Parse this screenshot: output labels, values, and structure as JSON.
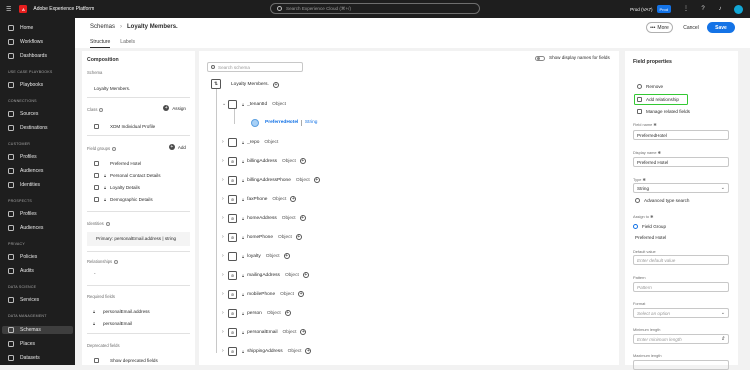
{
  "topbar": {
    "brand": "Adobe Experience Platform",
    "search_placeholder": "Search Experience Cloud (⌘+/)",
    "org": "Prod (VA7)",
    "env_badge": "Prod"
  },
  "nav": {
    "items": [
      {
        "label": "Home",
        "icon": "home-icon"
      },
      {
        "label": "Workflows",
        "icon": "workflows-icon"
      },
      {
        "label": "Dashboards",
        "icon": "dashboards-icon"
      }
    ],
    "sections": [
      {
        "title": "USE CASE PLAYBOOKS",
        "items": [
          {
            "label": "Playbooks",
            "icon": "playbooks-icon"
          }
        ]
      },
      {
        "title": "CONNECTIONS",
        "items": [
          {
            "label": "Sources",
            "icon": "sources-icon"
          },
          {
            "label": "Destinations",
            "icon": "destinations-icon"
          }
        ]
      },
      {
        "title": "CUSTOMER",
        "items": [
          {
            "label": "Profiles",
            "icon": "profiles-icon"
          },
          {
            "label": "Audiences",
            "icon": "audiences-icon"
          },
          {
            "label": "Identities",
            "icon": "identities-icon"
          }
        ]
      },
      {
        "title": "PROSPECTS",
        "items": [
          {
            "label": "Profiles",
            "icon": "profiles-icon"
          },
          {
            "label": "Audiences",
            "icon": "audiences-icon"
          }
        ]
      },
      {
        "title": "PRIVACY",
        "items": [
          {
            "label": "Policies",
            "icon": "policies-icon"
          },
          {
            "label": "Audits",
            "icon": "audits-icon"
          }
        ]
      },
      {
        "title": "DATA SCIENCE",
        "items": [
          {
            "label": "Services",
            "icon": "services-icon"
          }
        ]
      },
      {
        "title": "DATA MANAGEMENT",
        "items": [
          {
            "label": "Schemas",
            "icon": "schemas-icon"
          },
          {
            "label": "Places",
            "icon": "places-icon"
          },
          {
            "label": "Datasets",
            "icon": "datasets-icon"
          }
        ]
      }
    ]
  },
  "header": {
    "breadcrumb_root": "Schemas",
    "breadcrumb_current": "Loyalty Members.",
    "tabs": [
      "Structure",
      "Labels"
    ],
    "more_label": "More",
    "cancel_label": "Cancel",
    "save_label": "Save"
  },
  "composition": {
    "title": "Composition",
    "schema_label": "Schema",
    "schema_value": "Loyalty Members.",
    "class_label": "Class",
    "assign_label": "Assign",
    "class_value": "XDM Individual Profile",
    "field_groups_label": "Field groups",
    "add_label": "Add",
    "field_groups": [
      "Preferred Hotel",
      "Personal Contact Details",
      "Loyalty Details",
      "Demographic Details"
    ],
    "identities_label": "Identities",
    "identity_value": "Primary: personalEmail.address | string",
    "relationships_label": "Relationships",
    "relationships_value": "-",
    "required_label": "Required fields",
    "required_fields": [
      "personalEmail.address",
      "personalEmail"
    ],
    "deprecated_label": "Deprecated fields",
    "deprecated_checkbox": "Show deprecated fields"
  },
  "canvas": {
    "search_placeholder": "Search schema",
    "display_names_label": "Show display names for fields",
    "root_name": "Loyalty Members.",
    "selected_field": {
      "name": "PreferredHotel",
      "type": "String"
    },
    "fields": [
      {
        "name": "_tenantId",
        "type": "Object"
      },
      {
        "name": "_repo",
        "type": "Object"
      },
      {
        "name": "billingAddress",
        "type": "Object"
      },
      {
        "name": "billingAddressPhone",
        "type": "Object"
      },
      {
        "name": "faxPhone",
        "type": "Object"
      },
      {
        "name": "homeAddress",
        "type": "Object"
      },
      {
        "name": "homePhone",
        "type": "Object"
      },
      {
        "name": "loyalty",
        "type": "Object"
      },
      {
        "name": "mailingAddress",
        "type": "Object"
      },
      {
        "name": "mobilePhone",
        "type": "Object"
      },
      {
        "name": "person",
        "type": "Object"
      },
      {
        "name": "personalEmail",
        "type": "Object"
      },
      {
        "name": "shippingAddress",
        "type": "Object"
      }
    ]
  },
  "properties": {
    "title": "Field properties",
    "remove_label": "Remove",
    "add_relationship_label": "Add relationship",
    "manage_related_label": "Manage related fields",
    "field_name_label": "Field name",
    "field_name_value": "PreferredHotel",
    "display_name_label": "Display name",
    "display_name_value": "Preferred Hotel",
    "type_label": "Type",
    "type_value": "String",
    "advanced_search_label": "Advanced type search",
    "assign_to_label": "Assign to",
    "assign_option": "Field Group",
    "assign_value": "Preferred Hotel",
    "default_value_label": "Default value",
    "default_value_placeholder": "Enter default value",
    "pattern_label": "Pattern",
    "pattern_placeholder": "Pattern",
    "format_label": "Format",
    "format_placeholder": "Select an option",
    "min_length_label": "Minimum length",
    "min_length_placeholder": "Enter minimum length",
    "max_length_label": "Maximum length"
  }
}
